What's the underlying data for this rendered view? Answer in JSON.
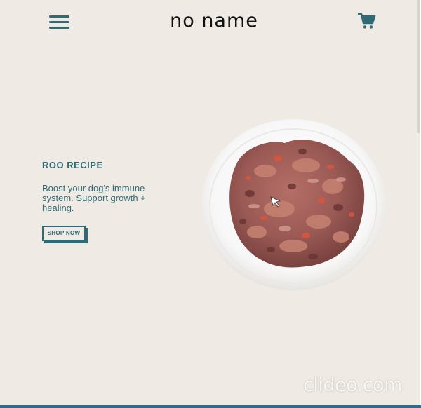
{
  "header": {
    "logo_text": "no name",
    "menu_icon": "hamburger-menu-icon",
    "cart_icon": "shopping-cart-icon"
  },
  "hero": {
    "title": "ROO RECIPE",
    "description": "Boost your dog's immune system. Support growth + healing.",
    "shop_label": "SHOP NOW",
    "image": "bowl-of-raw-dog-food"
  },
  "watermark": {
    "text": "clideo.com"
  },
  "colors": {
    "background": "#efebe4",
    "accent": "#2f6b76",
    "bottom_bar": "#2b6f8c"
  }
}
